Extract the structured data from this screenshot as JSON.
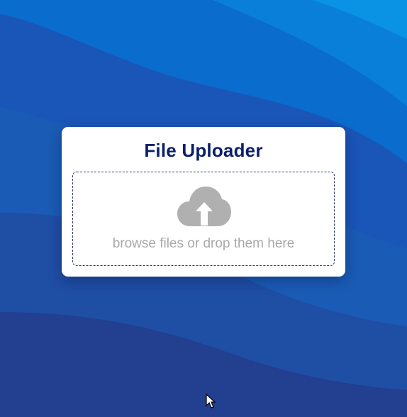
{
  "uploader": {
    "title": "File Uploader",
    "hint": "browse files or drop them here",
    "icon": "cloud-upload-icon"
  },
  "colors": {
    "title": "#0c1f6b",
    "hint": "#a8a8a8",
    "icon": "#b0b0b0",
    "background_top": "#0a8fe0",
    "background_bottom": "#1e3a8a"
  }
}
